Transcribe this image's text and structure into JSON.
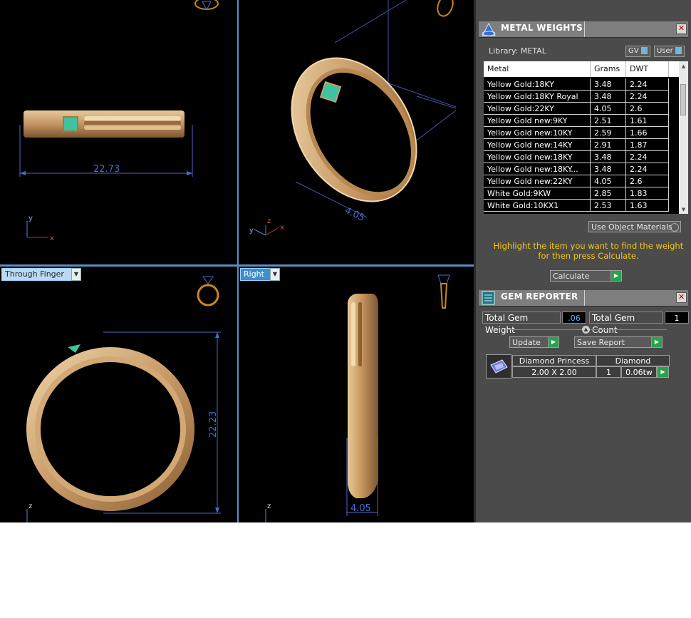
{
  "viewports": {
    "top_left": {
      "dimension": "22.73",
      "axis_labels": [
        "y",
        "x"
      ]
    },
    "top_right": {
      "dimension": "4.05",
      "axis_labels": [
        "z",
        "y",
        "x"
      ]
    },
    "bottom_left": {
      "view_name": "Through Finger",
      "dimension": "22.23",
      "axis_labels": [
        "z"
      ]
    },
    "bottom_right": {
      "view_name": "Right",
      "dimension": "4.05",
      "axis_labels": [
        "z"
      ]
    }
  },
  "metal_weights": {
    "title": "METAL WEIGHTS",
    "library_label": "Library: METAL",
    "gv_label": "GV",
    "user_label": "User",
    "columns": [
      "Metal",
      "Grams",
      "DWT"
    ],
    "rows": [
      [
        "Yellow Gold:18KY",
        "3.48",
        "2.24"
      ],
      [
        "Yellow Gold:18KY Royal",
        "3.48",
        "2.24"
      ],
      [
        "Yellow Gold:22KY",
        "4.05",
        "2.6"
      ],
      [
        "Yellow Gold new:9KY",
        "2.51",
        "1.61"
      ],
      [
        "Yellow Gold new:10KY",
        "2.59",
        "1.66"
      ],
      [
        "Yellow Gold new:14KY",
        "2.91",
        "1.87"
      ],
      [
        "Yellow Gold new:18KY",
        "3.48",
        "2.24"
      ],
      [
        "Yellow Gold new:18KY...",
        "3.48",
        "2.24"
      ],
      [
        "Yellow Gold new:22KY",
        "4.05",
        "2.6"
      ],
      [
        "White Gold:9KW",
        "2.85",
        "1.83"
      ],
      [
        "White Gold:10KX1",
        "2.53",
        "1.63"
      ]
    ],
    "use_object_materials": "Use Object Materials",
    "hint": "Highlight the item you want to find the weight for then press Calculate.",
    "calculate_label": "Calculate"
  },
  "gem_reporter": {
    "title": "GEM REPORTER",
    "total_weight_label": "Total Gem Weight",
    "total_weight_value": ".06",
    "total_count_label": "Total Gem Count",
    "total_count_value": "1",
    "update_label": "Update",
    "save_report_label": "Save Report",
    "gem": {
      "name": "Diamond Princess",
      "material": "Diamond",
      "size": "2.00 X 2.00",
      "count": "1",
      "weight": "0.06tw"
    }
  },
  "colors": {
    "gold": "#c8a06a",
    "dimension_blue": "#4a6ad0",
    "gem_green": "#3fc3a0",
    "hint_yellow": "#f3c518"
  },
  "icons": [
    "ring-top-icon",
    "ring-side-icon",
    "ring-front-icon",
    "ring-profile-icon",
    "metal-weights-icon",
    "gem-reporter-icon",
    "gem-thumbnail-icon",
    "close-icon",
    "calculate-go-icon"
  ]
}
